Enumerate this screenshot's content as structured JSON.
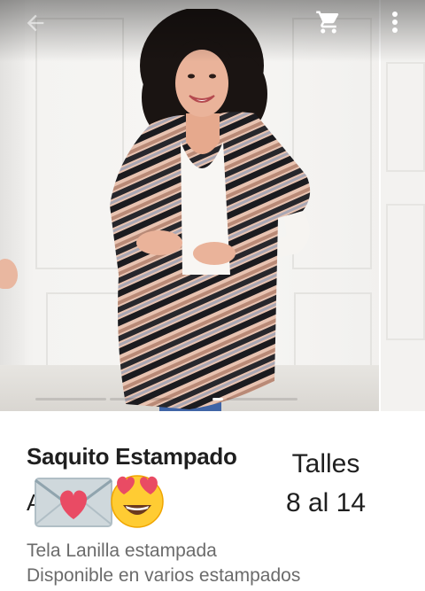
{
  "toolbar": {
    "back_icon": "arrow-back-icon",
    "cart_icon": "shopping-cart-icon",
    "more_icon": "more-vert-icon"
  },
  "gallery": {
    "image_count": 4,
    "active_index": 1
  },
  "product": {
    "title": "Saquito Estampado",
    "cut_letter": "A",
    "emojis": [
      "love-letter-emoji",
      "heart-eyes-emoji"
    ],
    "sizes_line1": "Talles",
    "sizes_line2": "8 al 14",
    "desc_line1": "Tela Lanilla estampada",
    "desc_line2": "Disponible en varios estampados"
  },
  "colors": {
    "text_primary": "#1f1f1f",
    "text_secondary": "#6b6b6b"
  }
}
